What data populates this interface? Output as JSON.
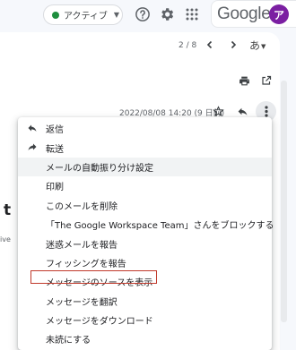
{
  "status": {
    "label": "アクティブ",
    "color": "#1e8e3e"
  },
  "header": {
    "icons": [
      "help-icon",
      "settings-icon",
      "apps-grid-icon"
    ],
    "logo_text": "Google",
    "avatar_initial": "ア",
    "avatar_color": "#7b1fa2"
  },
  "toolbar": {
    "pager": "2 / 8",
    "language": "あ"
  },
  "message": {
    "timestamp": "2022/08/08 14:20 (9 日前)",
    "partial_title": "t o",
    "partial_text": "ive"
  },
  "menu": {
    "items": [
      {
        "label": "返信",
        "icon": "reply-icon"
      },
      {
        "label": "転送",
        "icon": "forward-icon"
      },
      {
        "label": "メールの自動振り分け設定",
        "icon": ""
      },
      {
        "label": "印刷",
        "icon": ""
      },
      {
        "label": "このメールを削除",
        "icon": ""
      },
      {
        "label": "「The Google Workspace Team」さんをブロックする",
        "icon": ""
      },
      {
        "label": "迷惑メールを報告",
        "icon": ""
      },
      {
        "label": "フィッシングを報告",
        "icon": ""
      },
      {
        "label": "メッセージのソースを表示",
        "icon": ""
      },
      {
        "label": "メッセージを翻訳",
        "icon": ""
      },
      {
        "label": "メッセージをダウンロード",
        "icon": ""
      },
      {
        "label": "未読にする",
        "icon": ""
      }
    ],
    "hovered_index": 2,
    "highlighted_index": 8
  }
}
